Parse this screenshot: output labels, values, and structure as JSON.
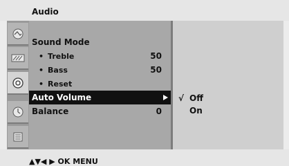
{
  "header": {
    "title": "Audio"
  },
  "sidebar": {
    "icons": [
      {
        "name": "picture-icon"
      },
      {
        "name": "setup-icon"
      },
      {
        "name": "audio-icon",
        "active": true
      },
      {
        "name": "time-icon"
      },
      {
        "name": "option-icon"
      }
    ]
  },
  "menu": {
    "items": [
      {
        "label": "Sound Mode",
        "value": ""
      },
      {
        "label": "Treble",
        "value": "50"
      },
      {
        "label": "Bass",
        "value": "50"
      },
      {
        "label": "Reset",
        "value": ""
      },
      {
        "label": "Auto Volume",
        "value": ""
      },
      {
        "label": "Balance",
        "value": "0"
      }
    ]
  },
  "submenu": {
    "options": [
      {
        "label": "Off",
        "check": "√"
      },
      {
        "label": "On",
        "check": ""
      }
    ]
  },
  "footer": {
    "hint": "▲▼◀ ▶ OK  MENU"
  },
  "colors": {
    "selected_bg": "#111111",
    "selected_text": "#ffffff",
    "menu_bg": "#a8a8a8",
    "submenu_bg": "#cfcfcf"
  }
}
